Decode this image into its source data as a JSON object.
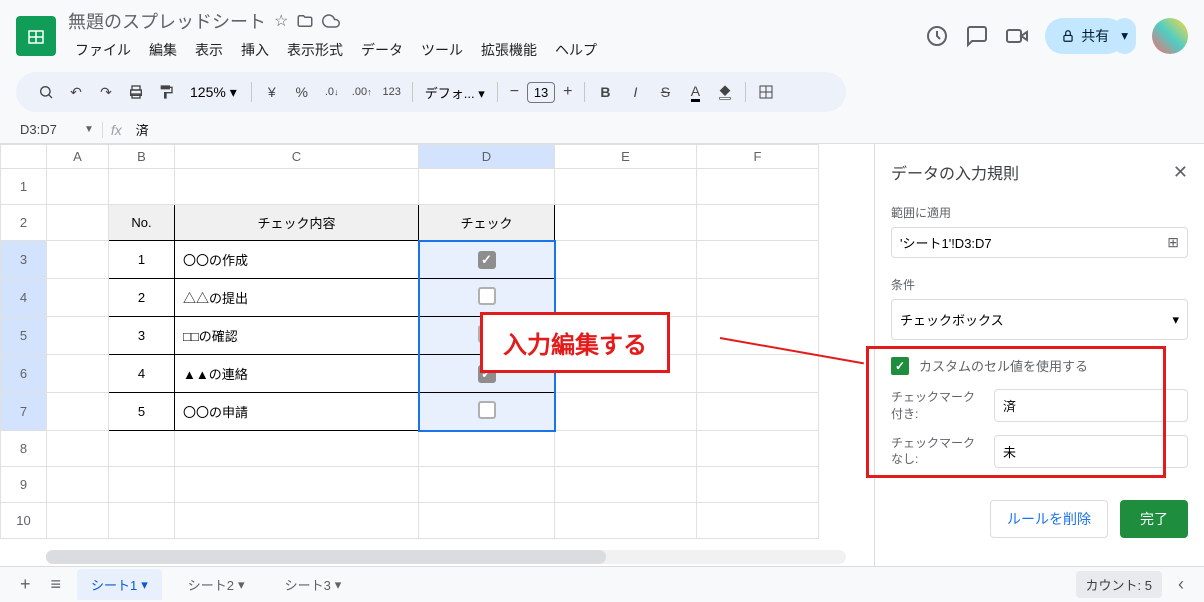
{
  "doc": {
    "title": "無題のスプレッドシート"
  },
  "menu": {
    "file": "ファイル",
    "edit": "編集",
    "view": "表示",
    "insert": "挿入",
    "format": "表示形式",
    "data": "データ",
    "tools": "ツール",
    "extensions": "拡張機能",
    "help": "ヘルプ"
  },
  "share": {
    "label": "共有"
  },
  "toolbar": {
    "zoom": "125%",
    "currency": "¥",
    "percent": "%",
    "dec_dec": ".0",
    "dec_inc": ".00",
    "num123": "123",
    "font": "デフォ...",
    "font_size": "13"
  },
  "namebox": {
    "range": "D3:D7",
    "formula": "済"
  },
  "columns": [
    "A",
    "B",
    "C",
    "D",
    "E",
    "F"
  ],
  "rows": [
    "1",
    "2",
    "3",
    "4",
    "5",
    "6",
    "7",
    "8",
    "9",
    "10"
  ],
  "table": {
    "headers": {
      "no": "No.",
      "content": "チェック内容",
      "check": "チェック"
    },
    "rows": [
      {
        "no": "1",
        "content": "〇〇の作成",
        "checked": true
      },
      {
        "no": "2",
        "content": "△△の提出",
        "checked": false
      },
      {
        "no": "3",
        "content": "□□の確認",
        "checked": false
      },
      {
        "no": "4",
        "content": "▲▲の連絡",
        "checked": true
      },
      {
        "no": "5",
        "content": "〇〇の申請",
        "checked": false
      }
    ]
  },
  "sidebar": {
    "title": "データの入力規則",
    "apply_to_label": "範囲に適用",
    "apply_to_value": "'シート1'!D3:D7",
    "condition_label": "条件",
    "condition_value": "チェックボックス",
    "custom_label": "カスタムのセル値を使用する",
    "checked_label": "チェックマーク付き:",
    "checked_value": "済",
    "unchecked_label": "チェックマークなし:",
    "unchecked_value": "未",
    "delete": "ルールを削除",
    "done": "完了"
  },
  "footer": {
    "sheets": [
      "シート1",
      "シート2",
      "シート3"
    ],
    "count": "カウント: 5"
  },
  "annotation": {
    "text": "入力編集する"
  }
}
